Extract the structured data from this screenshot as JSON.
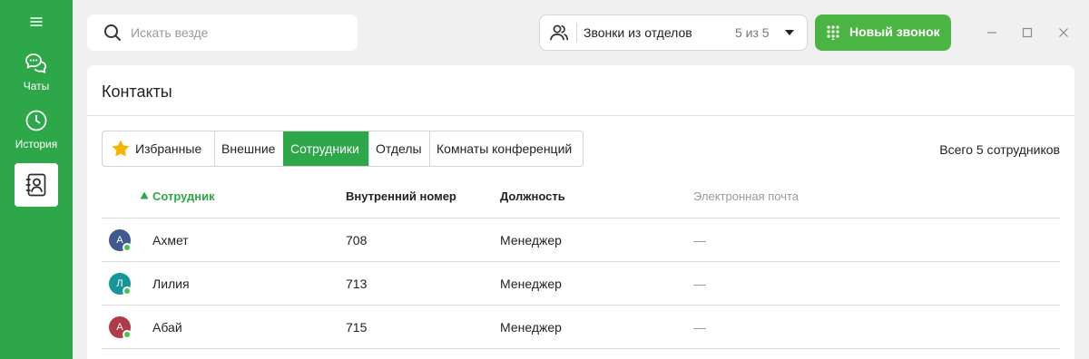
{
  "sidebar": {
    "chats_label": "Чаты",
    "history_label": "История",
    "icons": [
      "menu-icon",
      "chat-icon",
      "clock-icon",
      "contacts-icon"
    ]
  },
  "search": {
    "placeholder": "Искать везде"
  },
  "calls_filter": {
    "label": "Звонки из отделов",
    "count": "5 из 5"
  },
  "new_call": {
    "label": "Новый звонок"
  },
  "contacts": {
    "title": "Контакты",
    "tabs": [
      "Избранные",
      "Внешние",
      "Сотрудники",
      "Отделы",
      "Комнаты конференций"
    ],
    "active_tab": "Сотрудники",
    "total": "Всего 5 сотрудников",
    "columns": {
      "employee": "Сотрудник",
      "extension": "Внутренний номер",
      "position": "Должность",
      "email": "Электронная почта"
    },
    "rows": [
      {
        "initial": "А",
        "name": "Ахмет",
        "extension": "708",
        "position": "Менеджер",
        "email": "—",
        "avatar_color": "#3f5a8c",
        "status": "online"
      },
      {
        "initial": "Л",
        "name": "Лилия",
        "extension": "713",
        "position": "Менеджер",
        "email": "—",
        "avatar_color": "#17969a",
        "status": "online"
      },
      {
        "initial": "А",
        "name": "Абай",
        "extension": "715",
        "position": "Менеджер",
        "email": "—",
        "avatar_color": "#b03a48",
        "status": "online"
      }
    ]
  },
  "colors": {
    "sidebar": "#2ea64a",
    "accent": "#2ea64a",
    "new_call_button": "#4bb543",
    "status_online": "#3dc94a"
  }
}
